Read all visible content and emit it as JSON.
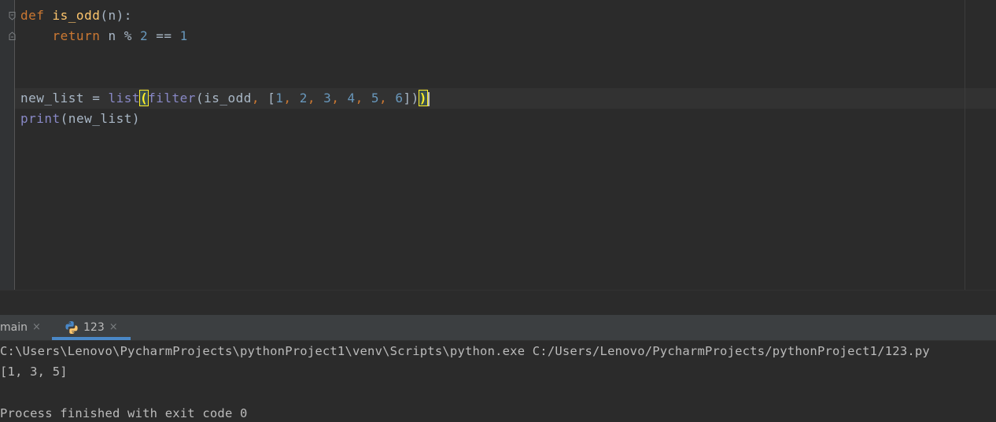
{
  "editor": {
    "lines": [
      {
        "tokens": [
          {
            "t": "def ",
            "c": "kw"
          },
          {
            "t": "is_odd",
            "c": "fn"
          },
          {
            "t": "(n):",
            "c": "op"
          }
        ]
      },
      {
        "tokens": [
          {
            "t": "    return ",
            "c": "kw"
          },
          {
            "t": "n % ",
            "c": "op"
          },
          {
            "t": "2",
            "c": "num"
          },
          {
            "t": " == ",
            "c": "op"
          },
          {
            "t": "1",
            "c": "num"
          }
        ]
      },
      {
        "tokens": [
          {
            "t": "new_list = ",
            "c": "op"
          },
          {
            "t": "list",
            "c": "bi"
          },
          {
            "t": "(",
            "c": "brace"
          },
          {
            "t": "filter",
            "c": "bi"
          },
          {
            "t": "(is_odd",
            "c": "op"
          },
          {
            "t": ", ",
            "c": "kw"
          },
          {
            "t": "[",
            "c": "op"
          },
          {
            "t": "1",
            "c": "num"
          },
          {
            "t": ", ",
            "c": "kw"
          },
          {
            "t": "2",
            "c": "num"
          },
          {
            "t": ", ",
            "c": "kw"
          },
          {
            "t": "3",
            "c": "num"
          },
          {
            "t": ", ",
            "c": "kw"
          },
          {
            "t": "4",
            "c": "num"
          },
          {
            "t": ", ",
            "c": "kw"
          },
          {
            "t": "5",
            "c": "num"
          },
          {
            "t": ", ",
            "c": "kw"
          },
          {
            "t": "6",
            "c": "num"
          },
          {
            "t": "])",
            "c": "op"
          },
          {
            "t": ")",
            "c": "brace"
          }
        ]
      },
      {
        "tokens": [
          {
            "t": "print",
            "c": "bi"
          },
          {
            "t": "(new_list)",
            "c": "op"
          }
        ]
      }
    ]
  },
  "run_window": {
    "tabs": [
      {
        "label": "main",
        "close": "×",
        "icon": "none"
      },
      {
        "label": "123",
        "close": "×",
        "icon": "python-icon"
      }
    ],
    "console": {
      "command": "C:\\Users\\Lenovo\\PycharmProjects\\pythonProject1\\venv\\Scripts\\python.exe C:/Users/Lenovo/PycharmProjects/pythonProject1/123.py",
      "output": "[1, 3, 5]",
      "blank": "",
      "exit_message": "Process finished with exit code 0"
    }
  },
  "colors": {
    "background": "#2b2b2b",
    "keyword": "#cc7832",
    "function": "#ffc66d",
    "builtin": "#8888c6",
    "number": "#6897bb",
    "text": "#a9b7c6",
    "tab_bar": "#3c3f41",
    "tab_underline": "#4a88c7"
  }
}
